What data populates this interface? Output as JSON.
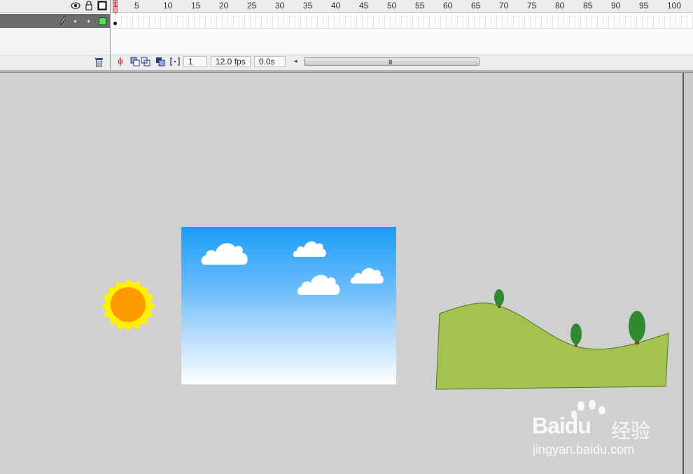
{
  "timeline": {
    "ruler_labels": [
      "1",
      "5",
      "10",
      "15",
      "20",
      "25",
      "30",
      "35",
      "40",
      "45",
      "50",
      "55",
      "60",
      "65",
      "70",
      "75",
      "80",
      "85",
      "90",
      "95",
      "100"
    ],
    "current_frame": "1",
    "frame_rate": "12.0 fps",
    "elapsed_time": "0.0s",
    "scroll_grip": "III",
    "scroll_left_arrow": "◂",
    "layer_color": "#4fe25b"
  },
  "icons": {
    "visibility": "eye-icon",
    "lock": "lock-icon",
    "outline": "outline-square-icon",
    "edit": "pencil-icon",
    "delete": "trash-icon"
  },
  "watermark": {
    "brand": "Bai",
    "brand_tail": "du",
    "cn_text": "经验",
    "url": "jingyan.baidu.com"
  },
  "colors": {
    "sky_top": "#1b9cf8",
    "sun_rays": "#fff200",
    "sun_core": "#ff9a00",
    "hill": "#a4c24f",
    "tree": "#2f8a2f"
  }
}
